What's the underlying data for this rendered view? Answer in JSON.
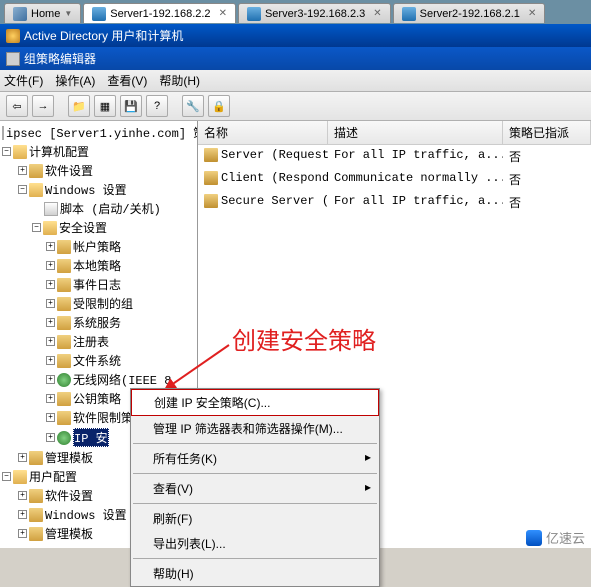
{
  "browser_tabs": {
    "tabs": [
      {
        "label": "Home",
        "active": false,
        "closable": false
      },
      {
        "label": "Server1-192.168.2.2",
        "active": true,
        "closable": true
      },
      {
        "label": "Server3-192.168.2.3",
        "active": false,
        "closable": true
      },
      {
        "label": "Server2-192.168.2.1",
        "active": false,
        "closable": true
      }
    ]
  },
  "mmc_bar": {
    "title": "Active Directory 用户和计算机"
  },
  "gp_window": {
    "title": "组策略编辑器"
  },
  "menu": {
    "file": "文件(F)",
    "action": "操作(A)",
    "view": "查看(V)",
    "help": "帮助(H)"
  },
  "tree": {
    "root": "ipsec [Server1.yinhe.com] 策",
    "computer_config": "计算机配置",
    "software_settings": "软件设置",
    "windows_settings": "Windows 设置",
    "scripts": "脚本 (启动/关机)",
    "security_settings": "安全设置",
    "account_policy": "帐户策略",
    "local_policy": "本地策略",
    "event_log": "事件日志",
    "restricted_groups": "受限制的组",
    "system_services": "系统服务",
    "registry": "注册表",
    "file_system": "文件系统",
    "wireless": "无线网络(IEEE 8",
    "public_key": "公钥策略",
    "software_restriction": "软件限制策略",
    "ip_security": "IP 安",
    "admin_templates": "管理模板",
    "user_config": "用户配置",
    "u_software_settings": "软件设置",
    "u_windows_settings": "Windows 设置",
    "u_admin_templates": "管理模板"
  },
  "list": {
    "headers": {
      "name": "名称",
      "desc": "描述",
      "assigned": "策略已指派"
    },
    "rows": [
      {
        "name": "Server (Request ...",
        "desc": "For all IP traffic, a...",
        "assigned": "否"
      },
      {
        "name": "Client (Respond ...",
        "desc": "Communicate normally ...",
        "assigned": "否"
      },
      {
        "name": "Secure Server (R...",
        "desc": "For all IP traffic, a...",
        "assigned": "否"
      }
    ]
  },
  "context_menu": {
    "create_ip": "创建 IP 安全策略(C)...",
    "manage_filters": "管理 IP 筛选器表和筛选器操作(M)...",
    "all_tasks": "所有任务(K)",
    "view": "查看(V)",
    "refresh": "刷新(F)",
    "export_list": "导出列表(L)...",
    "help": "帮助(H)"
  },
  "annotation": {
    "text": "创建安全策略"
  },
  "watermark": {
    "text": "亿速云"
  }
}
